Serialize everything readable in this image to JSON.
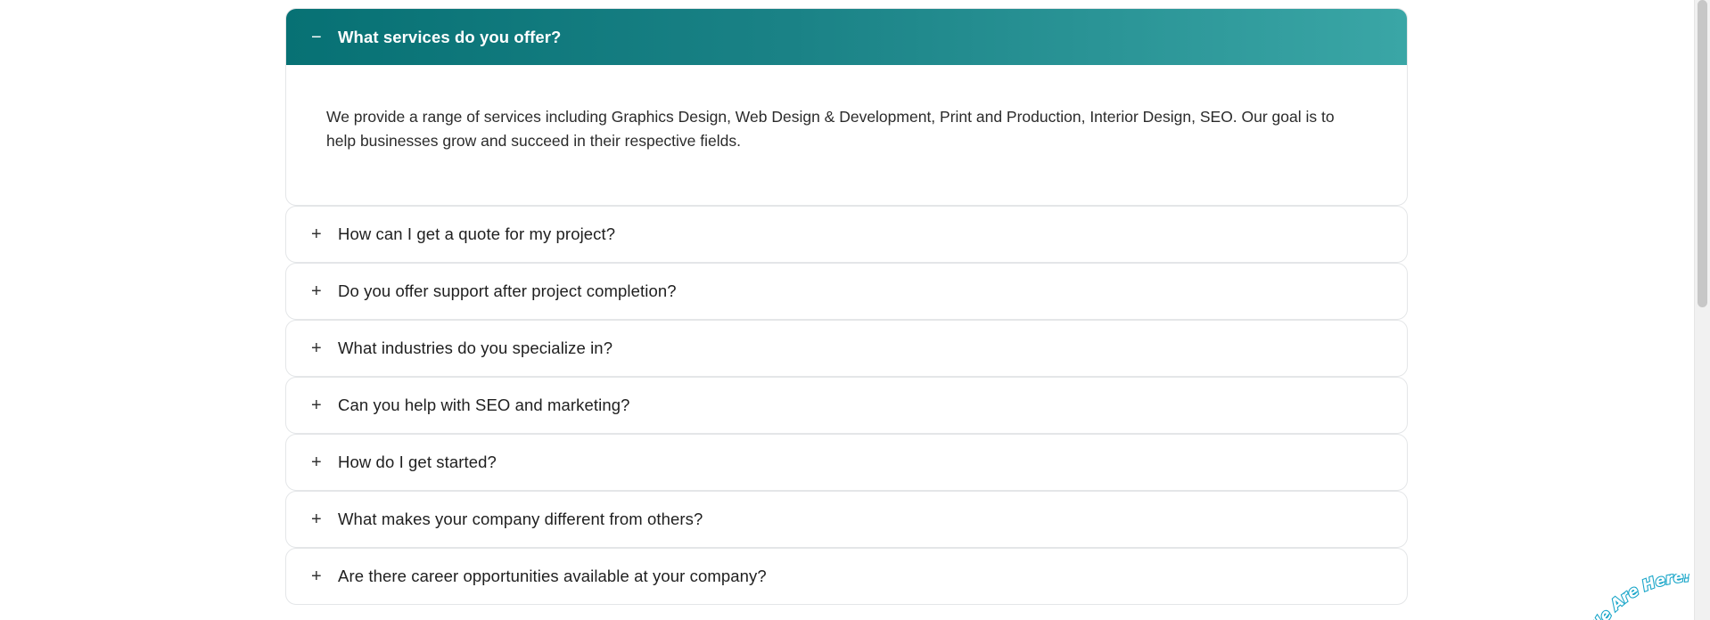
{
  "faq": {
    "items": [
      {
        "question": "What services do you offer?",
        "answer": "We provide a range of services including Graphics Design, Web Design & Development, Print and Production, Interior Design, SEO. Our goal is to help businesses grow and succeed in their respective fields.",
        "toggle": "−",
        "open": true
      },
      {
        "question": "How can I get a quote for my project?",
        "toggle": "+",
        "open": false
      },
      {
        "question": "Do you offer support after project completion?",
        "toggle": "+",
        "open": false
      },
      {
        "question": "What industries do you specialize in?",
        "toggle": "+",
        "open": false
      },
      {
        "question": "Can you help with SEO and marketing?",
        "toggle": "+",
        "open": false
      },
      {
        "question": "How do I get started?",
        "toggle": "+",
        "open": false
      },
      {
        "question": "What makes your company different from others?",
        "toggle": "+",
        "open": false
      },
      {
        "question": "Are there career opportunities available at your company?",
        "toggle": "+",
        "open": false
      }
    ]
  },
  "badge": {
    "text": "We Are Here!",
    "color": "#1aa6c9"
  },
  "colors": {
    "header_gradient_start": "#077174",
    "header_gradient_end": "#3aa6a6"
  }
}
